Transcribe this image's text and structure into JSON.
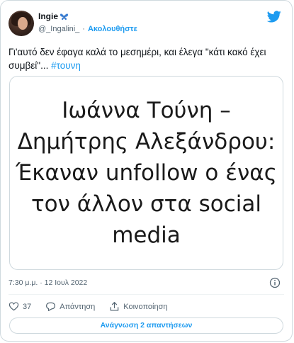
{
  "header": {
    "display_name": "Ingie",
    "handle": "@_Ingalini_",
    "separator": "·",
    "follow_label": "Ακολουθήστε"
  },
  "tweet": {
    "text": "Γι'αυτό δεν έφαγα καλά το μεσημέρι, και έλεγα \"κάτι κακό έχει συμβεί\"... ",
    "hashtag": "#τουνη"
  },
  "card": {
    "title": "Ιωάννα Τούνη – Δημήτρης Αλεξάνδρου: Έκαναν unfollow ο ένας τον άλλον στα social media"
  },
  "meta": {
    "timestamp": "7:30 μ.μ. · 12 Ιουλ 2022"
  },
  "actions": {
    "like_count": "37",
    "reply_label": "Απάντηση",
    "share_label": "Κοινοποίηση"
  },
  "footer": {
    "read_replies_label": "Ανάγνωση 2 απαντήσεων"
  },
  "colors": {
    "accent": "#1d9bf0",
    "text": "#0f1419",
    "secondary": "#536471",
    "border": "#cfd9de"
  },
  "icons": {
    "brand": "twitter-bird-icon",
    "badge": "butterfly-icon",
    "info": "info-icon",
    "like": "heart-icon",
    "reply": "reply-bubble-icon",
    "share": "share-icon"
  }
}
